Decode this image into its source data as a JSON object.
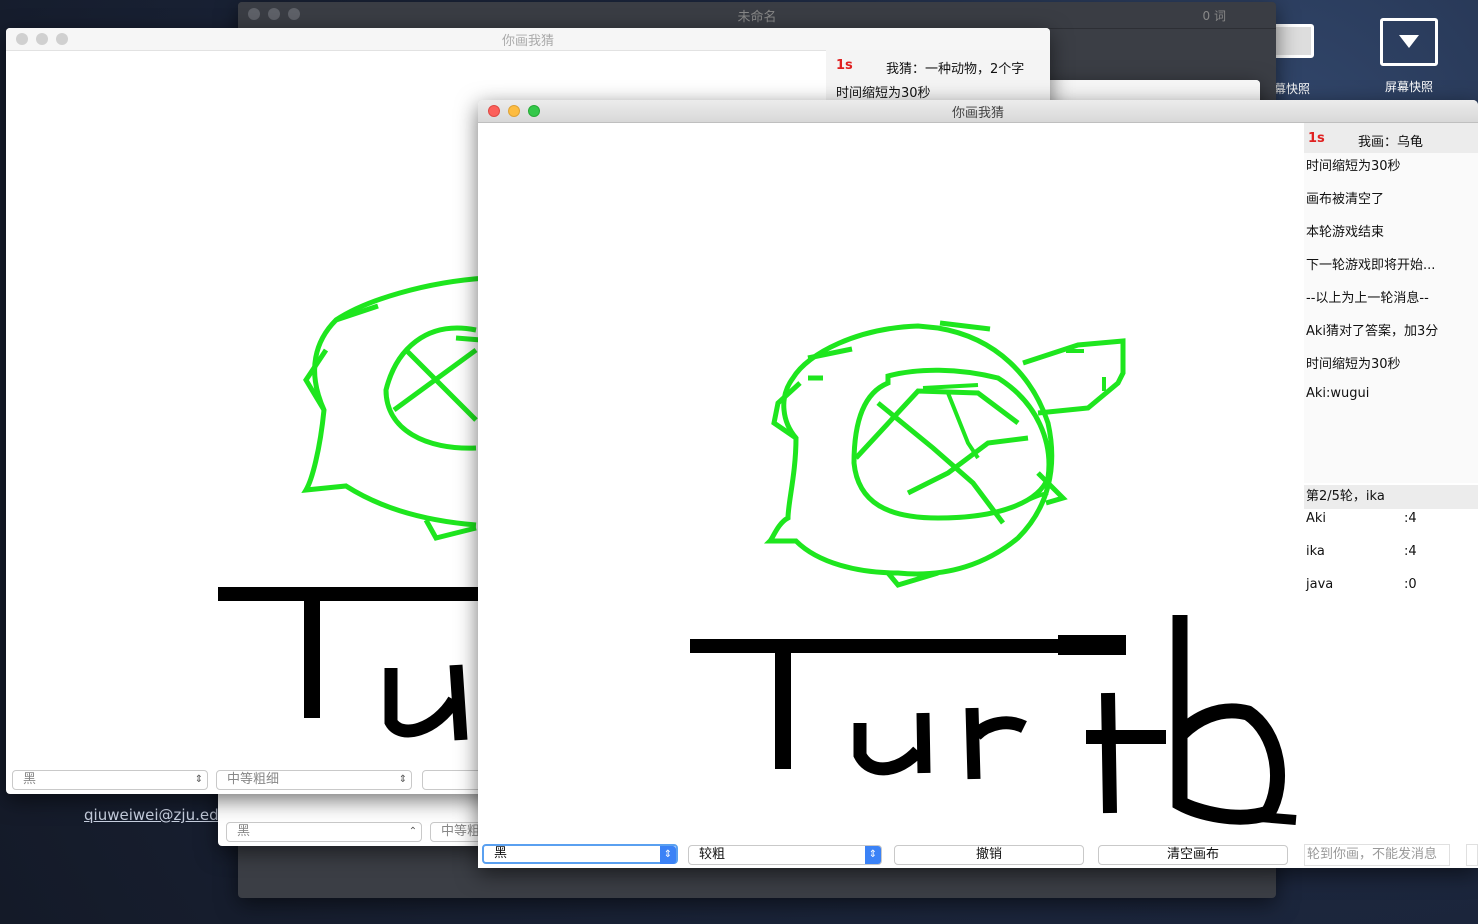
{
  "background_window": {
    "title": "未命名",
    "word_count": "0 词"
  },
  "dock": {
    "screenshot_partial_label": "幕快照",
    "screenshot_label": "屏幕快照"
  },
  "email_link": "qiuweiwei@zju.edu",
  "left_window": {
    "title": "你画我猜",
    "timer": "1s",
    "status": "我猜：一种动物，2个字",
    "message": "时间缩短为30秒",
    "color_select": "黑",
    "width_select": "中等粗细"
  },
  "middle_window": {
    "color_select": "黑",
    "width_select": "中等粗"
  },
  "main_window": {
    "title": "你画我猜",
    "timer": "1s",
    "status": "我画：乌龟",
    "messages": [
      "时间缩短为30秒",
      "画布被清空了",
      "本轮游戏结束",
      "下一轮游戏即将开始...",
      "--以上为上一轮消息--",
      "Aki猜对了答案，加3分",
      "时间缩短为30秒",
      "Aki:wugui"
    ],
    "round_info": "第2/5轮，ika",
    "scores": [
      {
        "name": "Aki",
        "score": ":4"
      },
      {
        "name": "ika",
        "score": ":4"
      },
      {
        "name": "java",
        "score": ":0"
      }
    ],
    "chat_placeholder": "轮到你画，不能发消息",
    "toolbar": {
      "color_select": "黑",
      "width_select": "较粗",
      "undo_button": "撤销",
      "clear_button": "清空画布"
    }
  },
  "colors": {
    "stroke_green": "#1ee61e",
    "stroke_black": "#000000",
    "timer_red": "#e02020"
  }
}
